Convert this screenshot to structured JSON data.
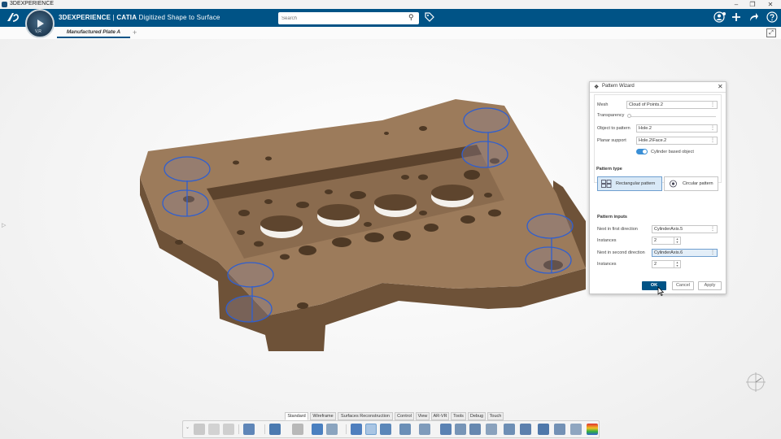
{
  "window": {
    "title": "3DEXPERIENCE"
  },
  "header": {
    "brand": "3DEXPERIENCE",
    "separator": " | ",
    "product": "CATIA",
    "app_name": "Digitized Shape to Surface",
    "compass_label": "V,R",
    "search_placeholder": "Search"
  },
  "tabs": [
    {
      "label": "Manufactured Plate A"
    }
  ],
  "dialog": {
    "title": "Pattern Wizard",
    "mesh_label": "Mesh",
    "mesh_value": "Cloud of Points.2",
    "transparency_label": "Transparency",
    "object_label": "Object to pattern",
    "object_value": "Hole.2",
    "support_label": "Planar support",
    "support_value": "Hole.2\\Face.2",
    "cylinder_label": "Cylinder based object",
    "pattern_type_label": "Pattern type",
    "rectangular_label": "Rectangular pattern",
    "circular_label": "Circular pattern",
    "inputs_label": "Pattern inputs",
    "first_dir_label": "Next in first direction",
    "first_dir_value": "CylinderAxis.5",
    "instances_label": "Instances",
    "instances1_value": "2",
    "second_dir_label": "Next in second direction",
    "second_dir_value": "CylinderAxis.6",
    "instances2_value": "2",
    "ok_label": "OK",
    "cancel_label": "Cancel",
    "apply_label": "Apply"
  },
  "command_tabs": [
    {
      "label": "Standard"
    },
    {
      "label": "Wireframe"
    },
    {
      "label": "Surfaces Reconstruction"
    },
    {
      "label": "Control"
    },
    {
      "label": "View"
    },
    {
      "label": "AR-VR"
    },
    {
      "label": "Tools"
    },
    {
      "label": "Debug"
    },
    {
      "label": "Touch"
    }
  ],
  "colors": {
    "header_bg": "#005386",
    "model_fill": "#9c7b5b",
    "model_dark": "#6e5238",
    "selection_blue": "#2f5fd0",
    "toggle_on": "#3a8fd6"
  },
  "icons": [
    "ds-logo-icon",
    "search-icon",
    "tag-icon",
    "user-icon",
    "plus-icon",
    "share-icon",
    "help-icon",
    "fullscreen-icon",
    "pattern-wizard-icon",
    "close-icon",
    "compass-icon",
    "cursor-icon"
  ]
}
